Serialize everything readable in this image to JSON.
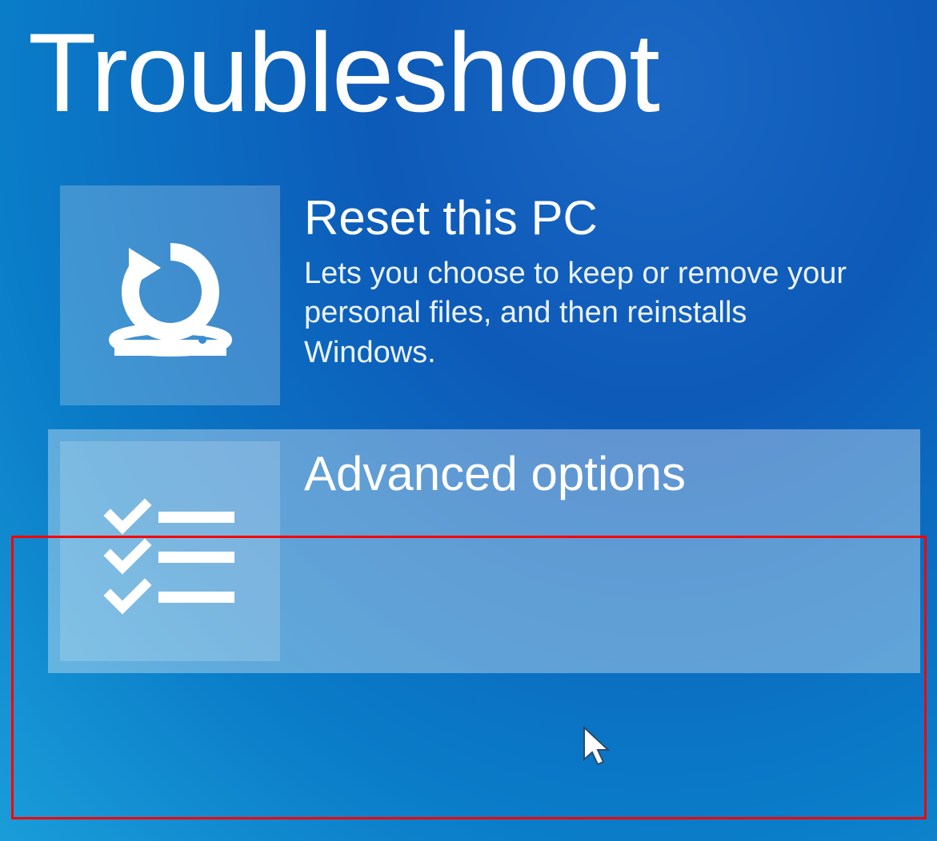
{
  "page": {
    "title": "Troubleshoot"
  },
  "options": [
    {
      "title": "Reset this PC",
      "description": "Lets you choose to keep or remove your personal files, and then reinstalls Windows.",
      "icon": "reset-icon"
    },
    {
      "title": "Advanced options",
      "description": "",
      "icon": "checklist-icon"
    }
  ],
  "colors": {
    "background_gradient_start": "#0d5ab8",
    "background_gradient_end": "#1a9dd9",
    "tile_bg": "rgba(255,255,255,0.22)",
    "tile_selected_bg": "rgba(255,255,255,0.35)",
    "highlight_border": "#ff0000",
    "text": "#ffffff"
  }
}
